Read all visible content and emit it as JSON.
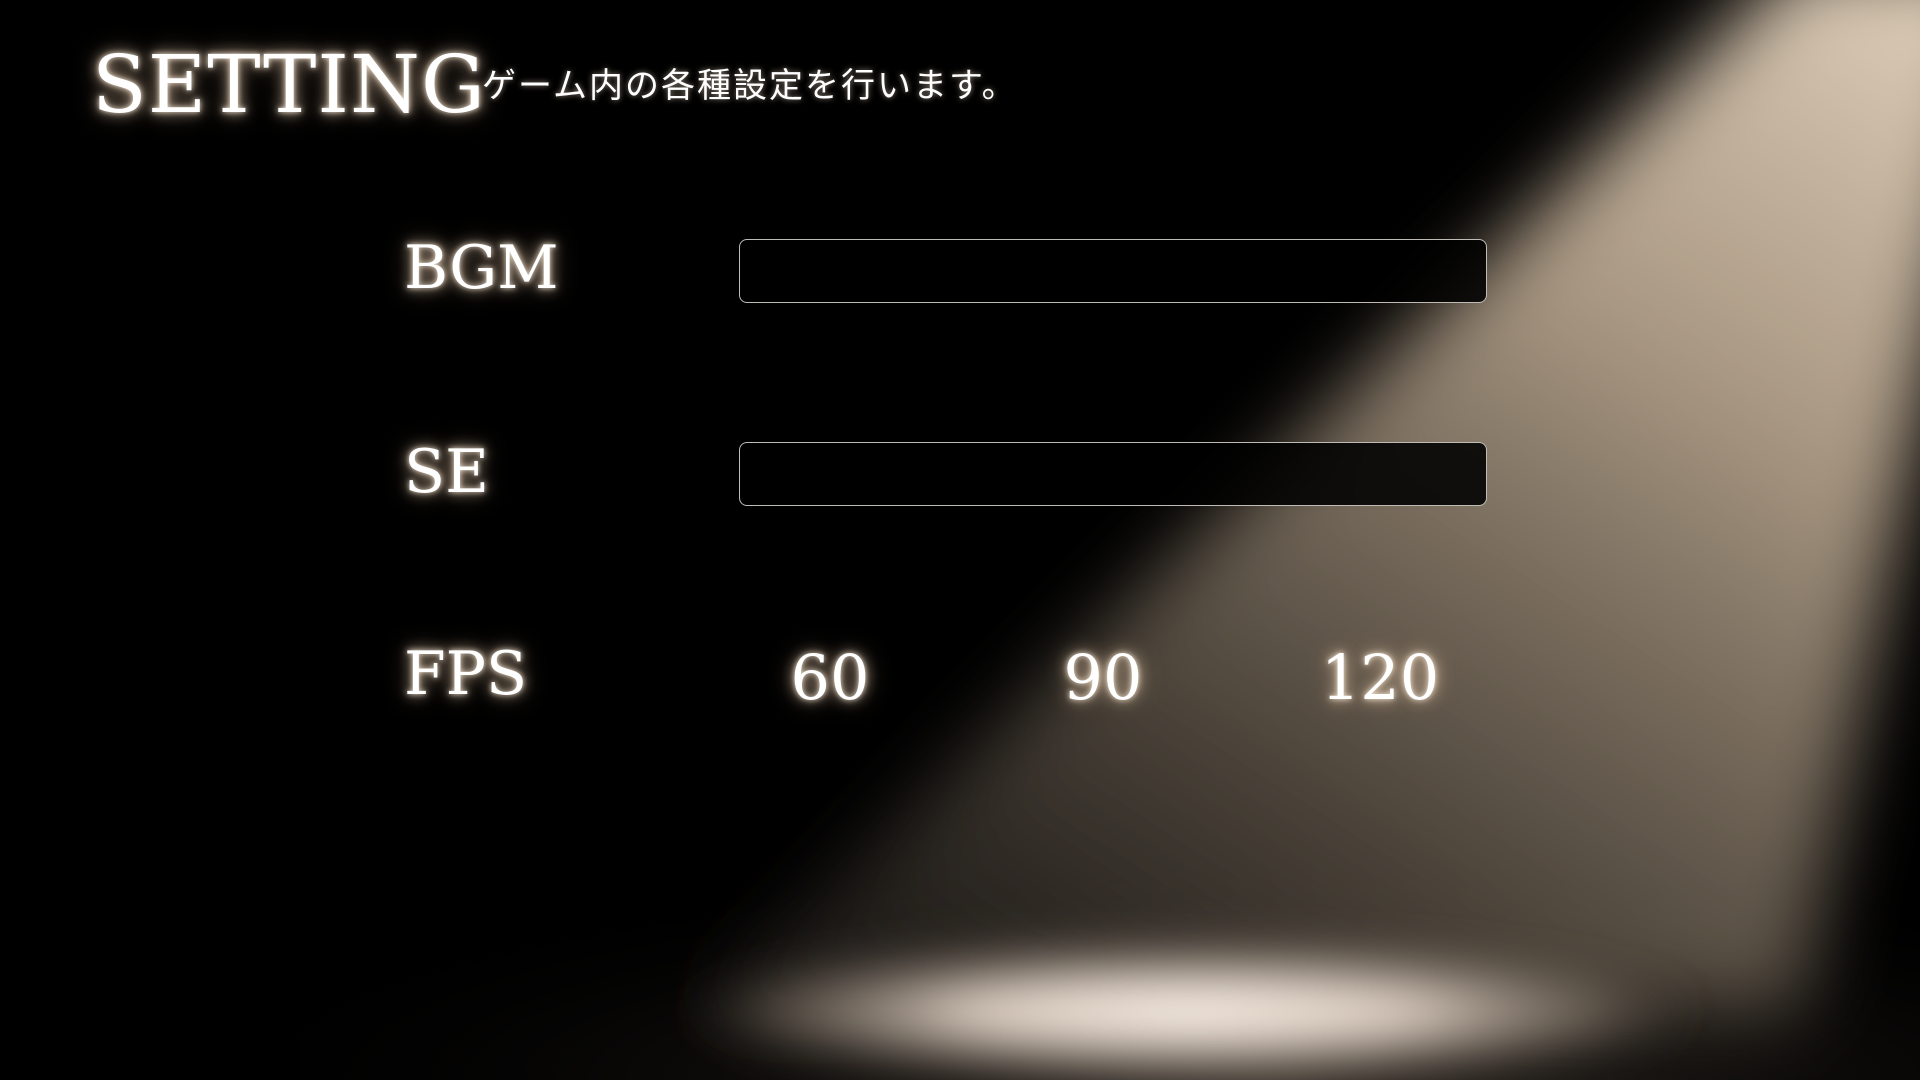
{
  "header": {
    "title": "SETTING",
    "subtitle": "ゲーム内の各種設定を行います。"
  },
  "settings": {
    "bgm": {
      "label": "BGM"
    },
    "se": {
      "label": "SE"
    },
    "fps": {
      "label": "FPS",
      "options": [
        "60",
        "90",
        "120"
      ]
    }
  },
  "colors": {
    "background": "#000000",
    "text": "#ffffff",
    "glow": "#ffe6c8",
    "slider_border": "#bfbcb8",
    "spotlight": "#e8d6bf"
  }
}
